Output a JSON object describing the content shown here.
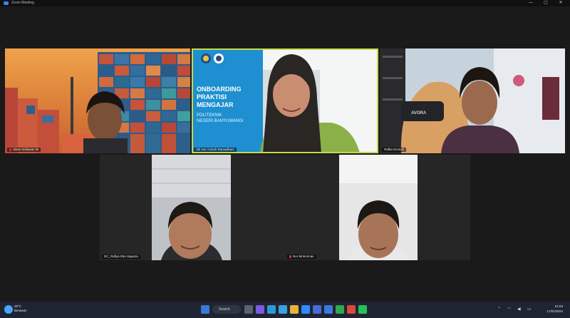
{
  "window": {
    "title": "Zoom Meeting",
    "controls": [
      "—",
      "▢",
      "✕"
    ]
  },
  "participants": [
    {
      "name": "Sikas Setiawan W",
      "muted": true
    },
    {
      "name": "Siti Nur Azizah Ramadhani",
      "muted": false,
      "active": true
    },
    {
      "name": "Rafka Dioniah",
      "muted": false
    },
    {
      "name": "DC_Rafiya Eka Saputra",
      "muted": false
    },
    {
      "name": "Nur Mohonnas",
      "muted": true
    }
  ],
  "slide": {
    "title_line1": "ONBOARDING",
    "title_line2": "PRAKTISI",
    "title_line3": "MENGAJAR",
    "sub_line1": "POLITEKNIK",
    "sub_line2": "NEGERI BANYUWANGI"
  },
  "shirt_brand": "AVORA",
  "taskbar": {
    "weather_temp": "29°C",
    "weather_desc": "Berawan",
    "search_label": "Search",
    "time": "21:03",
    "date": "17/01/2024"
  },
  "colors": {
    "active_speaker": "#c5d94b",
    "taskbar_bg": "#1f2530",
    "stage_bg": "#1a1a1a"
  }
}
